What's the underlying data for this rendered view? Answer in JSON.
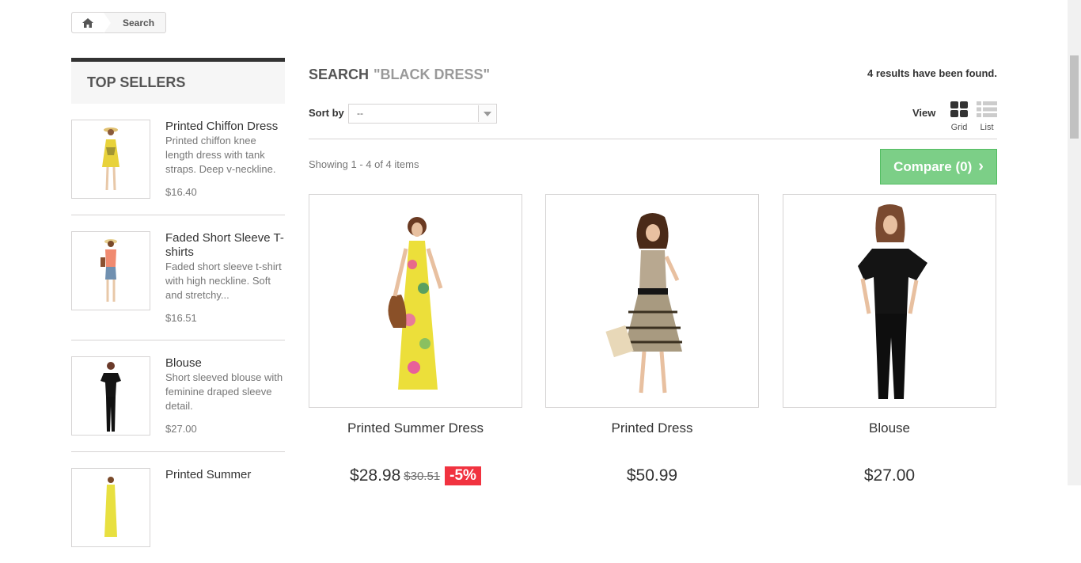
{
  "breadcrumb": {
    "home_icon": "home-icon",
    "current": "Search"
  },
  "top_sellers": {
    "title": "Top sellers",
    "items": [
      {
        "name": "Printed Chiffon Dress",
        "desc": "Printed chiffon knee length dress with tank straps. Deep v-neckline.",
        "price": "$16.40"
      },
      {
        "name": "Faded Short Sleeve T-shirts",
        "desc": "Faded short sleeve t-shirt with high neckline. Soft and stretchy...",
        "price": "$16.51"
      },
      {
        "name": "Blouse",
        "desc": "Short sleeved blouse with feminine draped sleeve detail.",
        "price": "$27.00"
      },
      {
        "name": "Printed Summer",
        "desc": "",
        "price": ""
      }
    ]
  },
  "search": {
    "label": "Search",
    "term": "\"black dress\"",
    "results": "4 results have been found."
  },
  "sort": {
    "label": "Sort by",
    "value": "--"
  },
  "view": {
    "label": "View",
    "grid": "Grid",
    "list": "List"
  },
  "showing": "Showing 1 - 4 of 4 items",
  "compare": {
    "label": "Compare (0)"
  },
  "products": [
    {
      "name": "Printed Summer Dress",
      "price": "$28.98",
      "old_price": "$30.51",
      "discount": "-5%"
    },
    {
      "name": "Printed Dress",
      "price": "$50.99",
      "old_price": "",
      "discount": ""
    },
    {
      "name": "Blouse",
      "price": "$27.00",
      "old_price": "",
      "discount": ""
    }
  ],
  "colors": {
    "accent_green": "#7ccf87",
    "discount_red": "#f13340"
  }
}
